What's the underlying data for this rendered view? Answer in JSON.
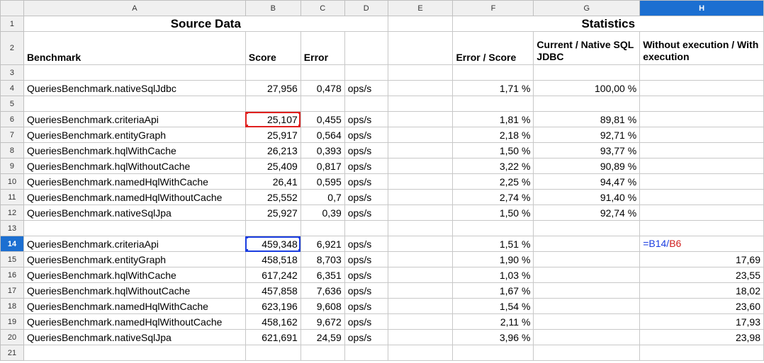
{
  "columns": [
    "A",
    "B",
    "C",
    "D",
    "E",
    "F",
    "G",
    "H"
  ],
  "active_column": "H",
  "active_row": "14",
  "titles": {
    "source": "Source Data",
    "statistics": "Statistics"
  },
  "headers": {
    "benchmark": "Benchmark",
    "score": "Score",
    "error": "Error",
    "error_score": "Error / Score",
    "current_native": "Current / Native SQL JDBC",
    "without_with": "Without execution / With execution"
  },
  "rows": [
    {
      "r": "3"
    },
    {
      "r": "4",
      "a": "QueriesBenchmark.nativeSqlJdbc",
      "b": "27,956",
      "c": "0,478",
      "d": "ops/s",
      "f": "1,71 %",
      "g": "100,00 %",
      "h": ""
    },
    {
      "r": "5"
    },
    {
      "r": "6",
      "a": "QueriesBenchmark.criteriaApi",
      "b": "25,107",
      "c": "0,455",
      "d": "ops/s",
      "f": "1,81 %",
      "g": "89,81 %",
      "h": ""
    },
    {
      "r": "7",
      "a": "QueriesBenchmark.entityGraph",
      "b": "25,917",
      "c": "0,564",
      "d": "ops/s",
      "f": "2,18 %",
      "g": "92,71 %",
      "h": ""
    },
    {
      "r": "8",
      "a": "QueriesBenchmark.hqlWithCache",
      "b": "26,213",
      "c": "0,393",
      "d": "ops/s",
      "f": "1,50 %",
      "g": "93,77 %",
      "h": ""
    },
    {
      "r": "9",
      "a": "QueriesBenchmark.hqlWithoutCache",
      "b": "25,409",
      "c": "0,817",
      "d": "ops/s",
      "f": "3,22 %",
      "g": "90,89 %",
      "h": ""
    },
    {
      "r": "10",
      "a": "QueriesBenchmark.namedHqlWithCache",
      "b": "26,41",
      "c": "0,595",
      "d": "ops/s",
      "f": "2,25 %",
      "g": "94,47 %",
      "h": ""
    },
    {
      "r": "11",
      "a": "QueriesBenchmark.namedHqlWithoutCache",
      "b": "25,552",
      "c": "0,7",
      "d": "ops/s",
      "f": "2,74 %",
      "g": "91,40 %",
      "h": ""
    },
    {
      "r": "12",
      "a": "QueriesBenchmark.nativeSqlJpa",
      "b": "25,927",
      "c": "0,39",
      "d": "ops/s",
      "f": "1,50 %",
      "g": "92,74 %",
      "h": ""
    },
    {
      "r": "13"
    },
    {
      "r": "14",
      "a": "QueriesBenchmark.criteriaApi",
      "b": "459,348",
      "c": "6,921",
      "d": "ops/s",
      "f": "1,51 %",
      "g": "",
      "h": ""
    },
    {
      "r": "15",
      "a": "QueriesBenchmark.entityGraph",
      "b": "458,518",
      "c": "8,703",
      "d": "ops/s",
      "f": "1,90 %",
      "g": "",
      "h": "17,69"
    },
    {
      "r": "16",
      "a": "QueriesBenchmark.hqlWithCache",
      "b": "617,242",
      "c": "6,351",
      "d": "ops/s",
      "f": "1,03 %",
      "g": "",
      "h": "23,55"
    },
    {
      "r": "17",
      "a": "QueriesBenchmark.hqlWithoutCache",
      "b": "457,858",
      "c": "7,636",
      "d": "ops/s",
      "f": "1,67 %",
      "g": "",
      "h": "18,02"
    },
    {
      "r": "18",
      "a": "QueriesBenchmark.namedHqlWithCache",
      "b": "623,196",
      "c": "9,608",
      "d": "ops/s",
      "f": "1,54 %",
      "g": "",
      "h": "23,60"
    },
    {
      "r": "19",
      "a": "QueriesBenchmark.namedHqlWithoutCache",
      "b": "458,162",
      "c": "9,672",
      "d": "ops/s",
      "f": "2,11 %",
      "g": "",
      "h": "17,93"
    },
    {
      "r": "20",
      "a": "QueriesBenchmark.nativeSqlJpa",
      "b": "621,691",
      "c": "24,59",
      "d": "ops/s",
      "f": "3,96 %",
      "g": "",
      "h": "23,98"
    },
    {
      "r": "21"
    }
  ],
  "formula": {
    "prefix": "=",
    "ref1": "B14",
    "op": "/",
    "ref2": "B6"
  },
  "colors": {
    "active_header": "#1c6fd1",
    "ref_blue": "#1a3de0",
    "ref_red": "#e0201f"
  }
}
